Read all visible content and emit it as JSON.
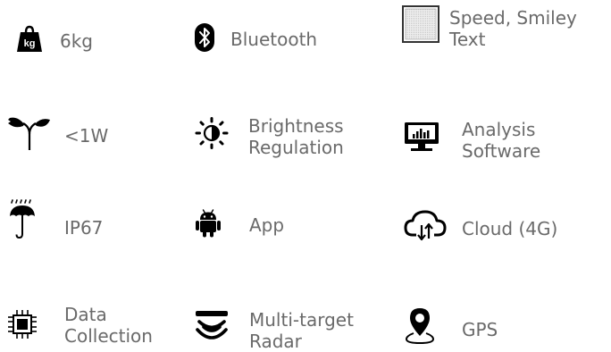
{
  "features": [
    {
      "id": "weight",
      "line1": "6kg",
      "line2": "",
      "icon": "kg-weight-icon"
    },
    {
      "id": "bluetooth",
      "line1": "Bluetooth",
      "line2": "",
      "icon": "bluetooth-icon"
    },
    {
      "id": "display",
      "line1": "Speed, Smiley",
      "line2": "Text",
      "icon": "led-display-icon"
    },
    {
      "id": "power",
      "line1": "<1W",
      "line2": "",
      "icon": "eco-plug-icon"
    },
    {
      "id": "brightness",
      "line1": "Brightness",
      "line2": "Regulation",
      "icon": "brightness-icon"
    },
    {
      "id": "software",
      "line1": "Analysis",
      "line2": "Software",
      "icon": "monitor-chart-icon"
    },
    {
      "id": "ip",
      "line1": "IP67",
      "line2": "",
      "icon": "umbrella-rain-icon"
    },
    {
      "id": "app",
      "line1": "App",
      "line2": "",
      "icon": "android-icon"
    },
    {
      "id": "cloud",
      "line1": "Cloud (4G)",
      "line2": "",
      "icon": "cloud-sync-icon"
    },
    {
      "id": "data",
      "line1": "Data",
      "line2": "Collection",
      "icon": "chip-icon"
    },
    {
      "id": "radar",
      "line1": "Multi-target",
      "line2": "Radar",
      "icon": "radar-waves-icon"
    },
    {
      "id": "gps",
      "line1": "GPS",
      "line2": "",
      "icon": "map-pin-icon"
    }
  ],
  "colors": {
    "icon": "#000000",
    "text": "#6a6a6a",
    "background": "#ffffff"
  }
}
